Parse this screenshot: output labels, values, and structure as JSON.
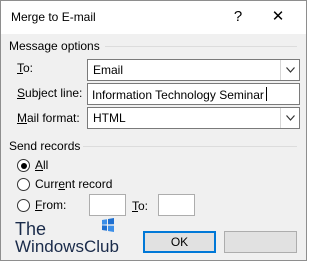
{
  "dialog": {
    "title": "Merge to E-mail",
    "help_glyph": "?",
    "close_glyph": "✕"
  },
  "message_options": {
    "label": "Message options",
    "to": {
      "label_key": "T",
      "label_rest": "o:",
      "value": "Email"
    },
    "subject": {
      "label_key": "S",
      "label_rest": "ubject line:",
      "value": "Information Technology Seminar"
    },
    "mail_format": {
      "label_key": "M",
      "label_rest": "ail format:",
      "value": "HTML"
    }
  },
  "send_records": {
    "label": "Send records",
    "all": {
      "label_key": "A",
      "label_rest": "ll",
      "selected": true
    },
    "current": {
      "label_pre": "Curr",
      "label_key": "e",
      "label_rest": "nt record",
      "selected": false
    },
    "from": {
      "label_key": "F",
      "label_rest": "rom:",
      "selected": false,
      "value": ""
    },
    "to": {
      "label_key": "T",
      "label_rest": "o:",
      "value": ""
    }
  },
  "buttons": {
    "ok": "OK",
    "cancel": ""
  },
  "watermark": {
    "line1": "The",
    "line2": "WindowsClub"
  },
  "colors": {
    "accent": "#0078d7",
    "dialog_bg": "#f0f0f0",
    "watermark_blue": "#1e6fd0"
  },
  "icons": {
    "combo_arrow": "chevron-down-icon"
  }
}
